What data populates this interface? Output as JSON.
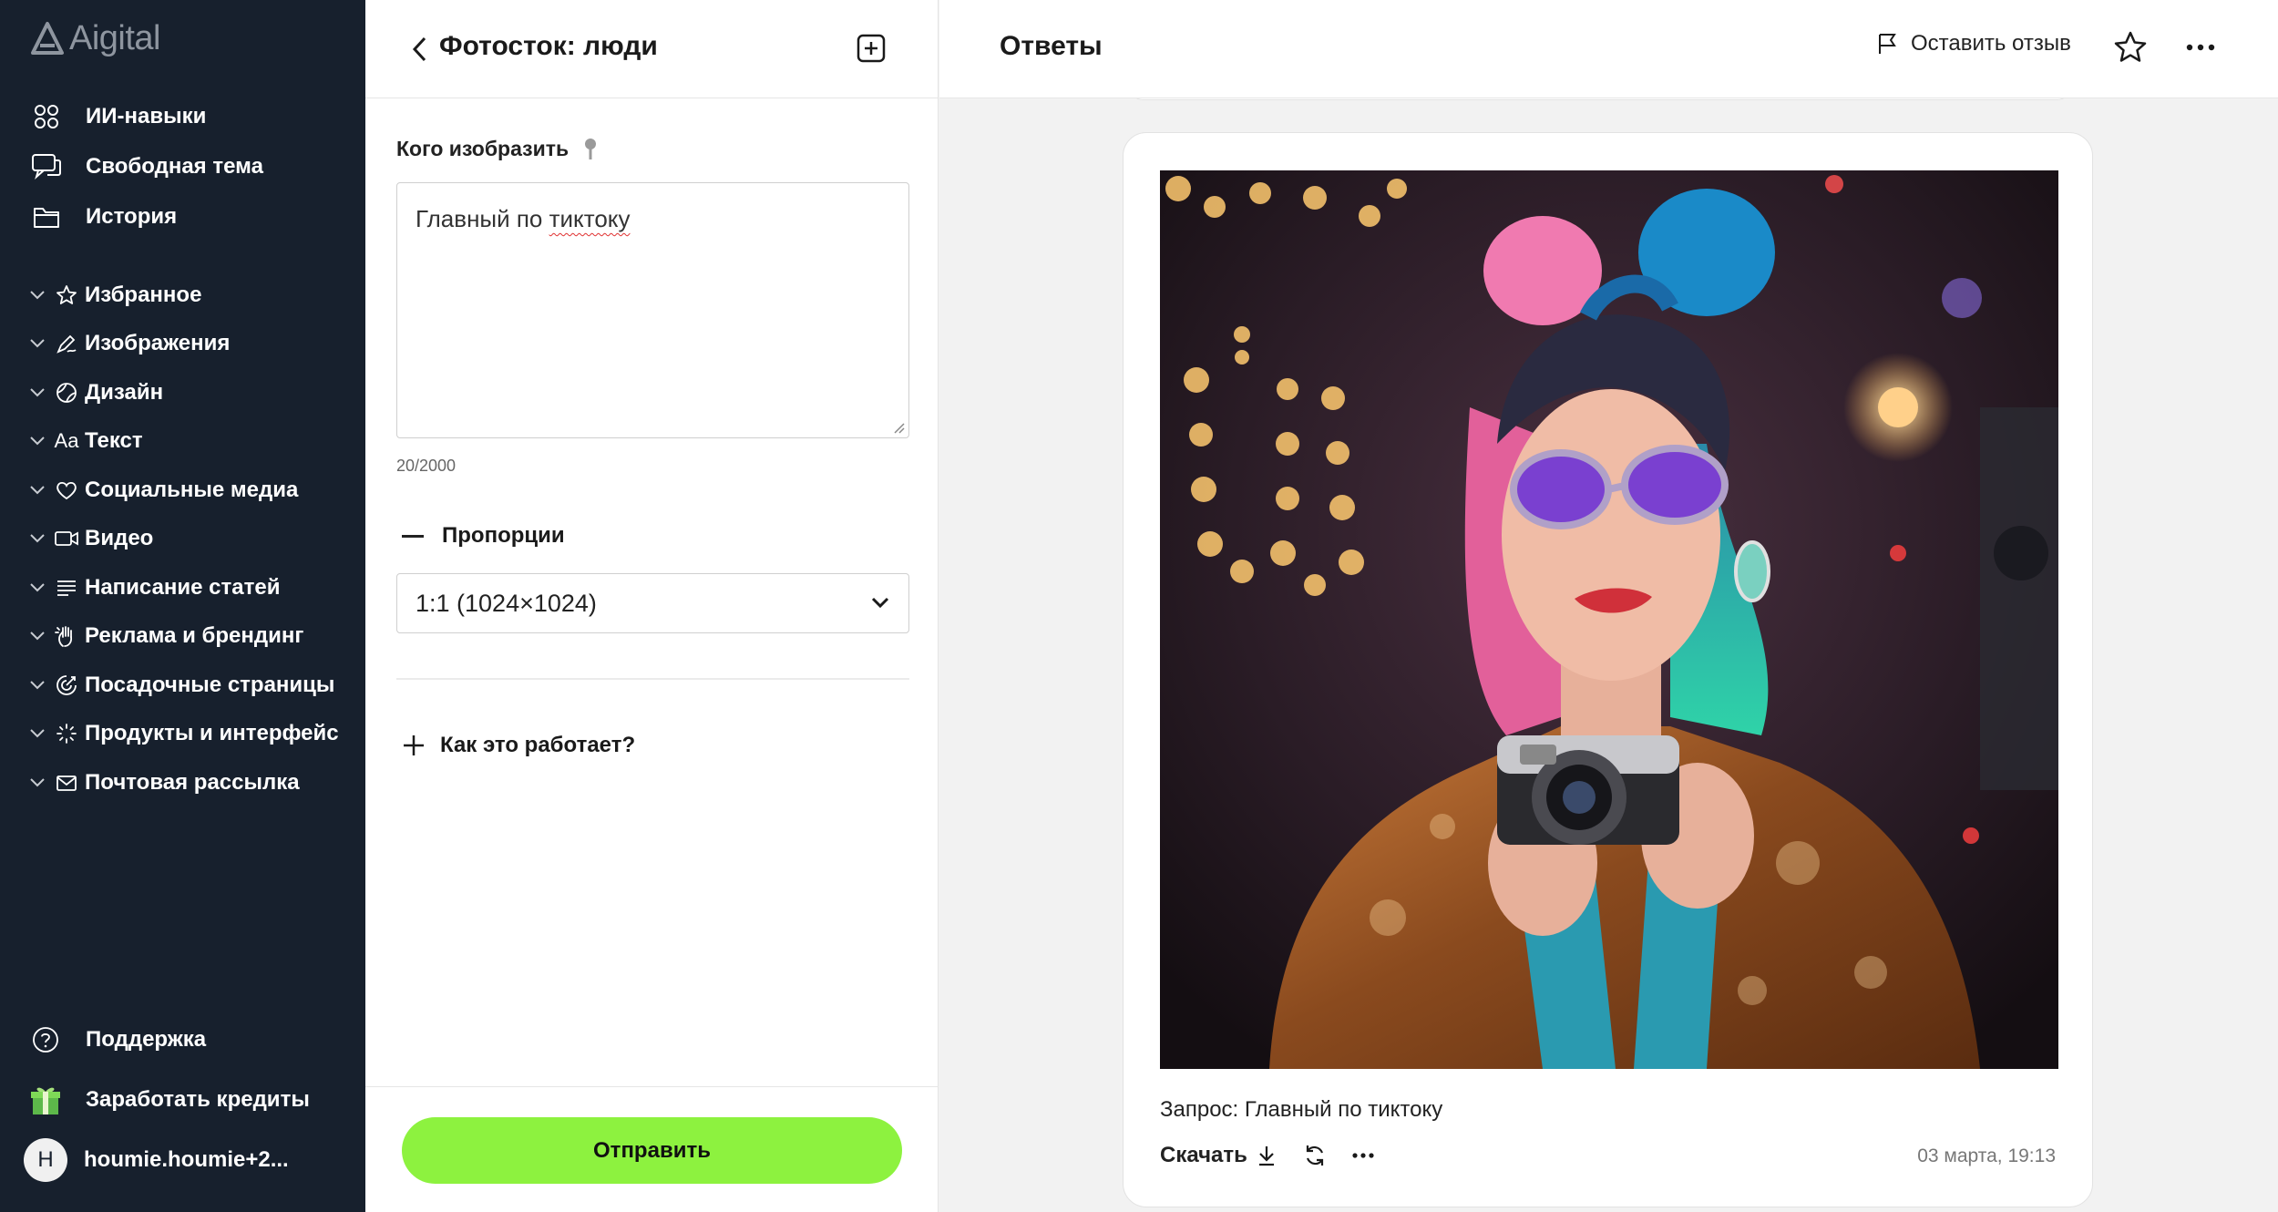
{
  "brand": {
    "name": "Aigital"
  },
  "sidebar": {
    "top_items": [
      {
        "label": "ИИ-навыки",
        "icon": "grid-icon"
      },
      {
        "label": "Свободная тема",
        "icon": "chat-icon"
      },
      {
        "label": "История",
        "icon": "folder-icon"
      }
    ],
    "categories": [
      {
        "label": "Избранное",
        "icon": "star-icon"
      },
      {
        "label": "Изображения",
        "icon": "pen-icon"
      },
      {
        "label": "Дизайн",
        "icon": "palette-icon"
      },
      {
        "label": "Текст",
        "icon": "text-icon",
        "icon_text": "Aa"
      },
      {
        "label": "Социальные медиа",
        "icon": "heart-icon"
      },
      {
        "label": "Видео",
        "icon": "video-icon"
      },
      {
        "label": "Написание статей",
        "icon": "lines-icon"
      },
      {
        "label": "Реклама и брендинг",
        "icon": "hand-icon"
      },
      {
        "label": "Посадочные страницы",
        "icon": "target-icon"
      },
      {
        "label": "Продукты и интерфейс",
        "icon": "sparkle-icon"
      },
      {
        "label": "Почтовая рассылка",
        "icon": "mail-icon"
      }
    ],
    "bottom_items": {
      "support": "Поддержка",
      "credits": "Заработать кредиты",
      "user_initial": "H",
      "user_name": "houmie.houmie+2..."
    }
  },
  "form": {
    "title": "Фотосток: люди",
    "field_label": "Кого изобразить",
    "prompt_value_before": "Главный по ",
    "prompt_value_misspelled": "тиктоку",
    "counter": "20/2000",
    "proportions_label": "Пропорции",
    "proportions_value": "1:1 (1024×1024)",
    "how_it_works": "Как это работает?",
    "submit_label": "Отправить"
  },
  "answers": {
    "title": "Ответы",
    "feedback_label": "Оставить отзыв",
    "request_text": "Запрос: Главный по тиктоку",
    "download_label": "Скачать",
    "timestamp": "03 марта, 19:13"
  },
  "colors": {
    "sidebar_bg": "#17202d",
    "accent_green": "#8df23f",
    "text_dark": "#1a1a1a"
  }
}
